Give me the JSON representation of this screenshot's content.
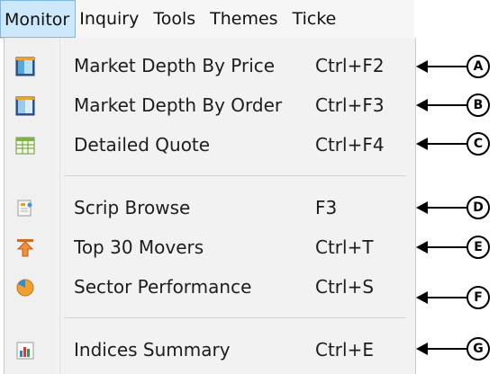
{
  "menubar": {
    "items": [
      {
        "label": "Monitor"
      },
      {
        "label": "Inquiry"
      },
      {
        "label": "Tools"
      },
      {
        "label": "Themes"
      },
      {
        "label": "Ticke"
      }
    ]
  },
  "monitor_menu": {
    "items": [
      {
        "label": "Market Depth By Price",
        "shortcut": "Ctrl+F2",
        "icon": "market-depth-price-icon"
      },
      {
        "label": "Market Depth By Order",
        "shortcut": "Ctrl+F3",
        "icon": "market-depth-order-icon"
      },
      {
        "label": "Detailed Quote",
        "shortcut": "Ctrl+F4",
        "icon": "detailed-quote-icon"
      },
      {
        "label": "Scrip Browse",
        "shortcut": "F3",
        "icon": "scrip-browse-icon"
      },
      {
        "label": "Top 30 Movers",
        "shortcut": "Ctrl+T",
        "icon": "top-movers-icon"
      },
      {
        "label": "Sector Performance",
        "shortcut": "Ctrl+S",
        "icon": "sector-performance-icon"
      },
      {
        "label": "Indices Summary",
        "shortcut": "Ctrl+E",
        "icon": "indices-summary-icon"
      }
    ]
  },
  "callouts": [
    "A",
    "B",
    "C",
    "D",
    "E",
    "F",
    "G"
  ],
  "colors": {
    "menubar_active_bg": "#cde8fa",
    "menubar_active_border": "#7db7e4",
    "menu_bg": "#f2f2f2"
  }
}
